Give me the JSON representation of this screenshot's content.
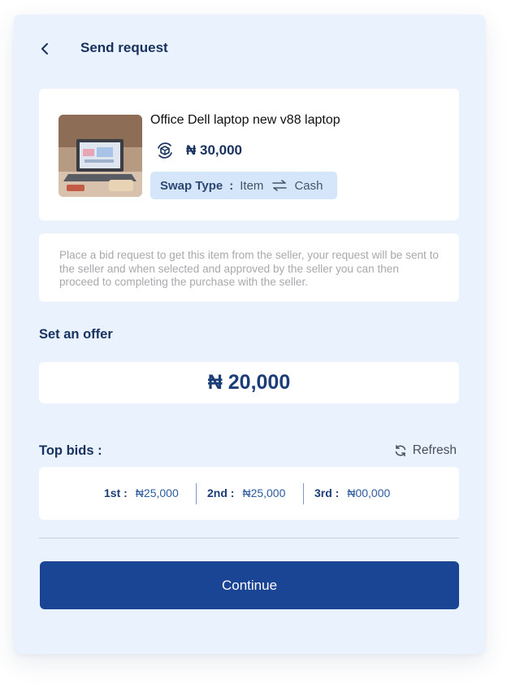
{
  "header": {
    "back_icon": "chevron-left-icon",
    "title": "Send request"
  },
  "product": {
    "name": "Office Dell laptop new v88 laptop",
    "price": "₦ 30,000",
    "swap_icon": "swap-cube-icon",
    "swap_type_label": "Swap Type",
    "swap_separator": ":",
    "swap_from": "Item",
    "swap_to": "Cash"
  },
  "info_text": "Place a bid request to get this item from the seller, your request will be sent to the seller and when selected and approved by the seller you can then proceed to completing the purchase with the seller.",
  "offer": {
    "label": "Set an offer",
    "value": "₦ 20,000"
  },
  "top_bids": {
    "label": "Top bids :",
    "refresh_label": "Refresh",
    "items": [
      {
        "rank": "1st :",
        "amount": "₦25,000"
      },
      {
        "rank": "2nd :",
        "amount": "₦25,000"
      },
      {
        "rank": "3rd :",
        "amount": "₦00,000"
      }
    ]
  },
  "continue_label": "Continue",
  "colors": {
    "panel_bg": "#eaf2fd",
    "primary": "#1a4494",
    "heading": "#17325e"
  }
}
